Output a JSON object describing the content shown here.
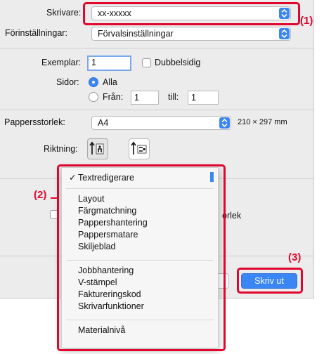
{
  "printer": {
    "label": "Skrivare:",
    "value": "xx-xxxxx"
  },
  "presets": {
    "label": "Förinställningar:",
    "value": "Förvalsinställningar"
  },
  "copies": {
    "label": "Exemplar:",
    "value": "1",
    "duplex_label": "Dubbelsidig"
  },
  "pages": {
    "label": "Sidor:",
    "all_label": "Alla",
    "from_label": "Från:",
    "from_value": "1",
    "to_label": "till:",
    "to_value": "1"
  },
  "paper_size": {
    "label": "Pappersstorlek:",
    "value": "A4",
    "dimensions": "210 × 297 mm"
  },
  "orientation": {
    "label": "Riktning:"
  },
  "background": {
    "partial_text": "orlek"
  },
  "buttons": {
    "print_label": "Skriv ut"
  },
  "menu": {
    "selected": "Textredigerare",
    "group1": [
      "Layout",
      "Färgmatchning",
      "Pappershantering",
      "Pappersmatare",
      "Skiljeblad"
    ],
    "group2": [
      "Jobbhantering",
      "V-stämpel",
      "Faktureringskod",
      "Skrivarfunktioner"
    ],
    "group3": [
      "Materialnivå"
    ]
  },
  "callouts": {
    "c1": "(1)",
    "c2": "(2)",
    "c3": "(3)"
  },
  "colors": {
    "accent": "#3a86f5",
    "callout_red": "#e0062e"
  }
}
